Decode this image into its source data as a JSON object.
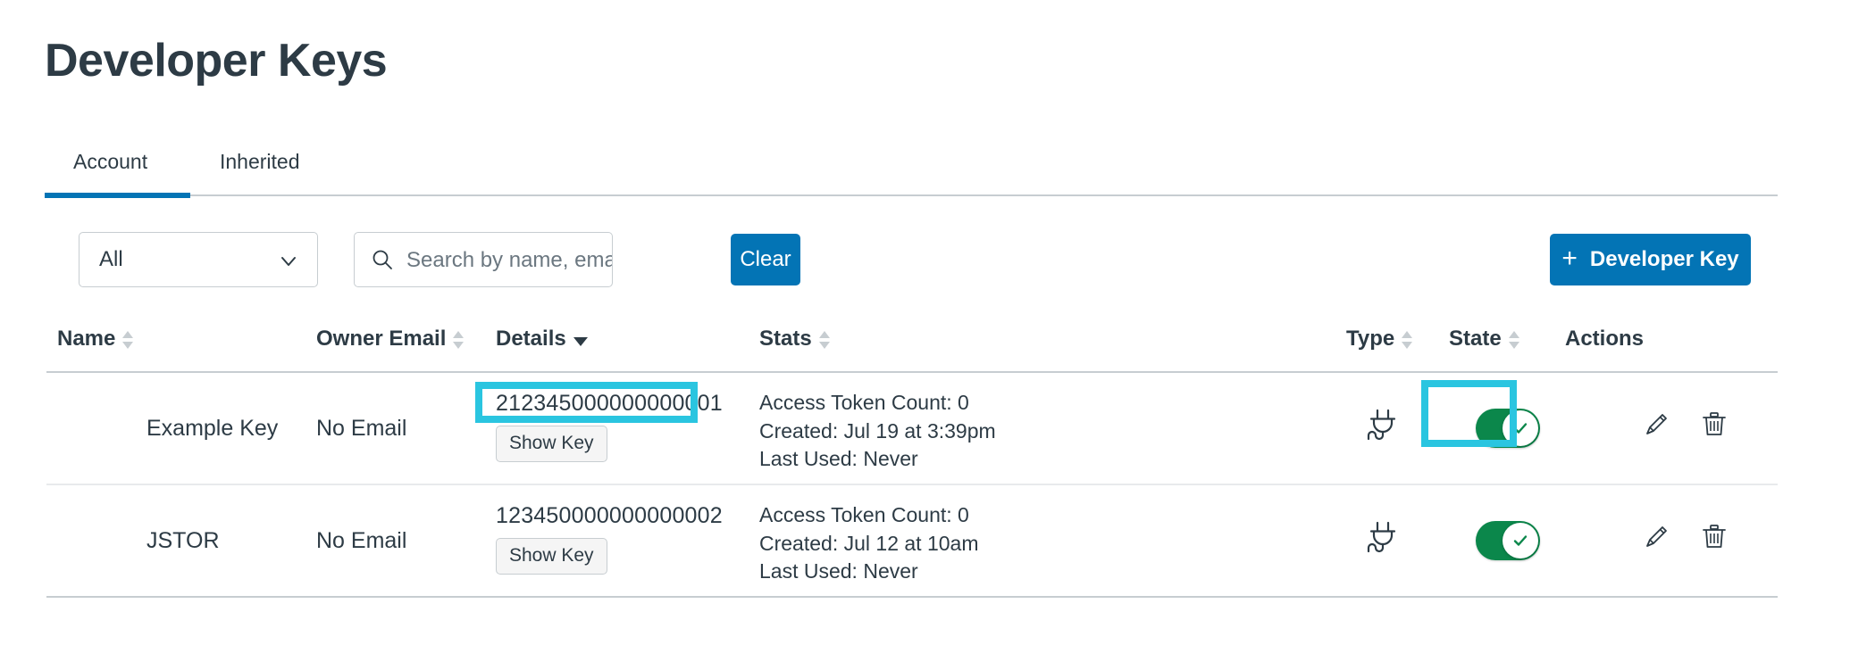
{
  "page": {
    "title": "Developer Keys"
  },
  "tabs": [
    {
      "label": "Account",
      "active": true
    },
    {
      "label": "Inherited",
      "active": false
    }
  ],
  "toolbar": {
    "filter_select": {
      "value": "All",
      "icon": "chevron-down-icon"
    },
    "search": {
      "placeholder": "Search by name, email, or",
      "value": "",
      "icon": "search-icon"
    },
    "clear_label": "Clear",
    "add_developer_key": {
      "label": "Developer Key",
      "icon": "plus-icon"
    },
    "accent_color": "#0374B5"
  },
  "table": {
    "columns": [
      {
        "label": "Name",
        "sort": "none"
      },
      {
        "label": "Owner Email",
        "sort": "none"
      },
      {
        "label": "Details",
        "sort": "desc"
      },
      {
        "label": "Stats",
        "sort": "none"
      },
      {
        "label": "Type",
        "sort": "none"
      },
      {
        "label": "State",
        "sort": "none"
      },
      {
        "label": "Actions",
        "sort": "static"
      }
    ],
    "show_key_label": "Show Key",
    "rows": [
      {
        "name": "Example Key",
        "owner_email": "No Email",
        "key_id": "212345000000000001",
        "stats": {
          "access_token_count": "Access Token Count: 0",
          "created": "Created: Jul 19 at 3:39pm",
          "last_used": "Last Used: Never"
        },
        "type_icon": "plug-icon",
        "state": "on",
        "actions": [
          "pencil-icon",
          "trash-icon"
        ]
      },
      {
        "name": "JSTOR",
        "owner_email": "No Email",
        "key_id": "123450000000000002",
        "stats": {
          "access_token_count": "Access Token Count: 0",
          "created": "Created: Jul 12 at 10am",
          "last_used": "Last Used: Never"
        },
        "type_icon": "plug-icon",
        "state": "on",
        "actions": [
          "pencil-icon",
          "trash-icon"
        ]
      }
    ]
  },
  "annotations": {
    "highlight_color": "#2AC5E0",
    "targets": [
      "row-2-key-id",
      "row-2-state-toggle"
    ]
  },
  "colors": {
    "text": "#2D3B45",
    "border": "#C7CDD1",
    "toggle_on": "#0B874B",
    "link": "#0374B5"
  }
}
